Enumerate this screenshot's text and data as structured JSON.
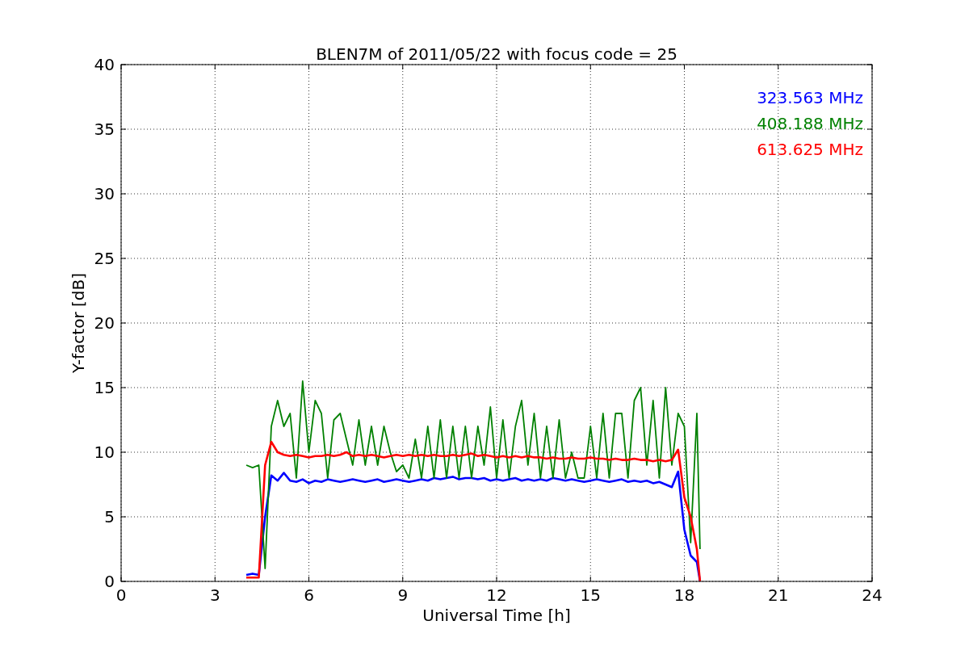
{
  "chart_data": {
    "type": "line",
    "title": "BLEN7M of 2011/05/22 with focus code = 25",
    "xlabel": "Universal Time [h]",
    "ylabel": "Y-factor [dB]",
    "x": [
      4,
      4.2,
      4.4,
      4.6,
      4.8,
      5,
      5.2,
      5.4,
      5.6,
      5.8,
      6,
      6.2,
      6.4,
      6.6,
      6.8,
      7,
      7.2,
      7.4,
      7.6,
      7.8,
      8,
      8.2,
      8.4,
      8.6,
      8.8,
      9,
      9.2,
      9.4,
      9.6,
      9.8,
      10,
      10.2,
      10.4,
      10.6,
      10.8,
      11,
      11.2,
      11.4,
      11.6,
      11.8,
      12,
      12.2,
      12.4,
      12.6,
      12.8,
      13,
      13.2,
      13.4,
      13.6,
      13.8,
      14,
      14.2,
      14.4,
      14.6,
      14.8,
      15,
      15.2,
      15.4,
      15.6,
      15.8,
      16,
      16.2,
      16.4,
      16.6,
      16.8,
      17,
      17.2,
      17.4,
      17.6,
      17.8,
      18,
      18.2,
      18.4,
      18.5
    ],
    "series": [
      {
        "name": "323.563 MHz",
        "color": "#0000ff",
        "values": [
          0.5,
          0.6,
          0.5,
          5,
          8.2,
          7.8,
          8.4,
          7.8,
          7.7,
          7.9,
          7.6,
          7.8,
          7.7,
          7.9,
          7.8,
          7.7,
          7.8,
          7.9,
          7.8,
          7.7,
          7.8,
          7.9,
          7.7,
          7.8,
          7.9,
          7.8,
          7.7,
          7.8,
          7.9,
          7.8,
          8.0,
          7.9,
          8.0,
          8.1,
          7.9,
          8.0,
          8.0,
          7.9,
          8.0,
          7.8,
          7.9,
          7.8,
          7.9,
          8.0,
          7.8,
          7.9,
          7.8,
          7.9,
          7.8,
          8.0,
          7.9,
          7.8,
          7.9,
          7.8,
          7.7,
          7.8,
          7.9,
          7.8,
          7.7,
          7.8,
          7.9,
          7.7,
          7.8,
          7.7,
          7.8,
          7.6,
          7.7,
          7.5,
          7.3,
          8.5,
          4,
          2,
          1.5,
          0
        ]
      },
      {
        "name": "408.188 MHz",
        "color": "#008000",
        "values": [
          9,
          8.8,
          9,
          1,
          12,
          14,
          12,
          13,
          8,
          15.5,
          10,
          14,
          13,
          8,
          12.5,
          13,
          11,
          9,
          12.5,
          9,
          12,
          9,
          12,
          10,
          8.5,
          9,
          8,
          11,
          8,
          12,
          8,
          12.5,
          8,
          12,
          8,
          12,
          8,
          12,
          9,
          13.5,
          8,
          12.5,
          8,
          12,
          14,
          9,
          13,
          8,
          12,
          8,
          12.5,
          8,
          10,
          8,
          8,
          12,
          8,
          13,
          8,
          13,
          13,
          8,
          14,
          15,
          9,
          14,
          8,
          15,
          9,
          13,
          12,
          3,
          13,
          2.5
        ]
      },
      {
        "name": "613.625 MHz",
        "color": "#ff0000",
        "values": [
          0.3,
          0.3,
          0.3,
          9,
          10.8,
          10.0,
          9.8,
          9.7,
          9.8,
          9.7,
          9.6,
          9.7,
          9.7,
          9.8,
          9.7,
          9.8,
          10.0,
          9.7,
          9.8,
          9.7,
          9.8,
          9.7,
          9.6,
          9.7,
          9.8,
          9.7,
          9.8,
          9.7,
          9.8,
          9.7,
          9.8,
          9.7,
          9.7,
          9.8,
          9.7,
          9.8,
          9.9,
          9.7,
          9.8,
          9.7,
          9.6,
          9.7,
          9.6,
          9.7,
          9.6,
          9.7,
          9.6,
          9.6,
          9.5,
          9.6,
          9.5,
          9.5,
          9.6,
          9.5,
          9.5,
          9.6,
          9.5,
          9.5,
          9.4,
          9.5,
          9.4,
          9.4,
          9.5,
          9.4,
          9.4,
          9.3,
          9.4,
          9.3,
          9.4,
          10.2,
          6.5,
          5,
          2.5,
          0
        ]
      }
    ],
    "grid": true,
    "xlim": [
      0,
      24
    ],
    "ylim": [
      0,
      40
    ],
    "xticks": [
      0,
      3,
      6,
      9,
      12,
      15,
      18,
      21,
      24
    ],
    "yticks": [
      0,
      5,
      10,
      15,
      20,
      25,
      30,
      35,
      40
    ]
  }
}
